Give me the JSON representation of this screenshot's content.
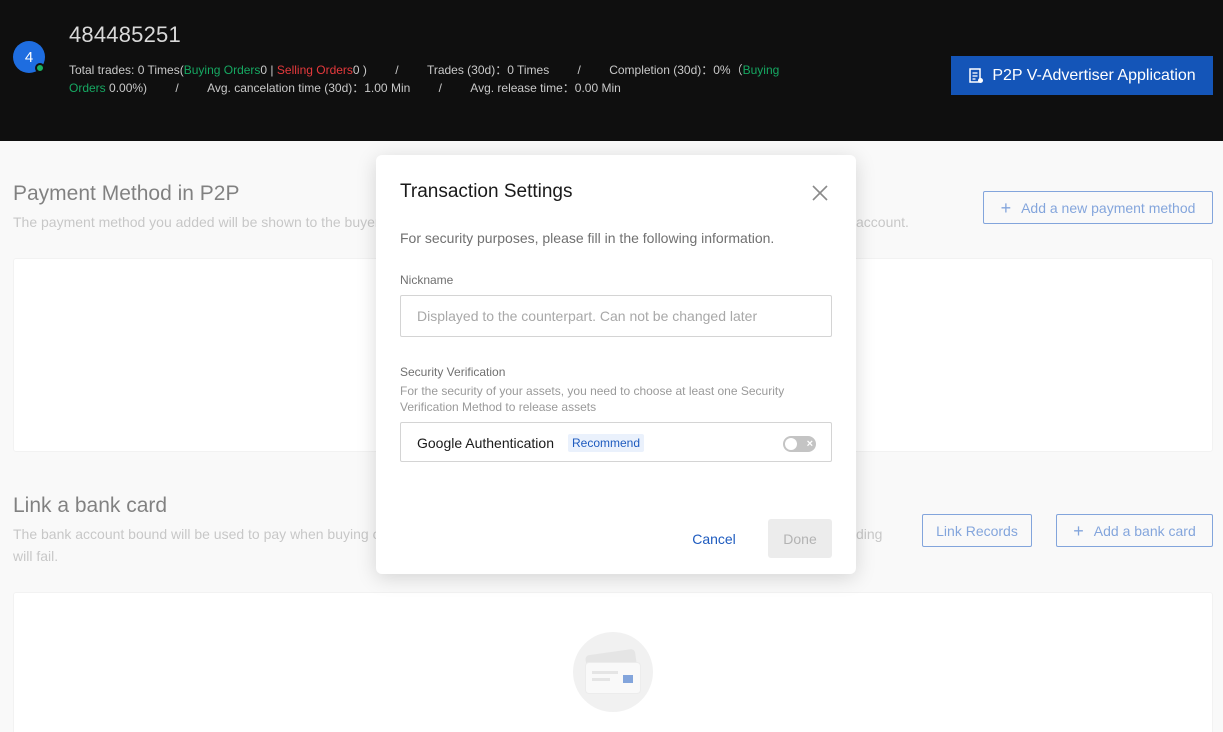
{
  "header": {
    "avatar_text": "4",
    "uid": "484485251",
    "stats": {
      "total_trades_prefix": "Total trades: 0 Times(",
      "buying_orders_label": "Buying Orders",
      "buying_orders_count": "0 |",
      "selling_orders_label": "Selling Orders",
      "selling_orders_count": "0 )",
      "separator": "/",
      "trades_30d": "Trades (30d)：0 Times",
      "completion_30d": "Completion (30d)：0%（",
      "completion_buying_label": "Buying Orders",
      "completion_buying_value": "0.00%)",
      "avg_cancel_time": "Avg. cancelation time (30d)：1.00 Min",
      "avg_release_time": "Avg. release time：0.00 Min"
    },
    "advertiser_button": "P2P V-Advertiser Application",
    "advertiser_icon": "document-icon"
  },
  "payment_section": {
    "title": "Payment Method in P2P",
    "description": "The payment method you added will be shown to the buyer",
    "description_tail": "account.",
    "add_button": "Add a new payment method"
  },
  "bank_section": {
    "title": "Link a bank card",
    "description_line1": "The bank account bound will be used to pay when buying c",
    "description_tail": "ding",
    "description_line2": "will fail.",
    "records_button": "Link Records",
    "add_button": "Add a bank card"
  },
  "modal": {
    "title": "Transaction Settings",
    "intro": "For security purposes, please fill in the following information.",
    "nickname_label": "Nickname",
    "nickname_placeholder": "Displayed to the counterpart. Can not be changed later",
    "nickname_value": "",
    "security_label": "Security Verification",
    "security_help": "For the security of your assets, you need to choose at least one Security Verification Method to release assets",
    "method_name": "Google Authentication",
    "method_tag": "Recommend",
    "toggle_state": "off",
    "cancel_button": "Cancel",
    "done_button": "Done"
  },
  "colors": {
    "accent": "#1e5bbf",
    "header_bg": "#0f0f0f",
    "buying_green": "#16a862",
    "selling_red": "#e4393c"
  }
}
